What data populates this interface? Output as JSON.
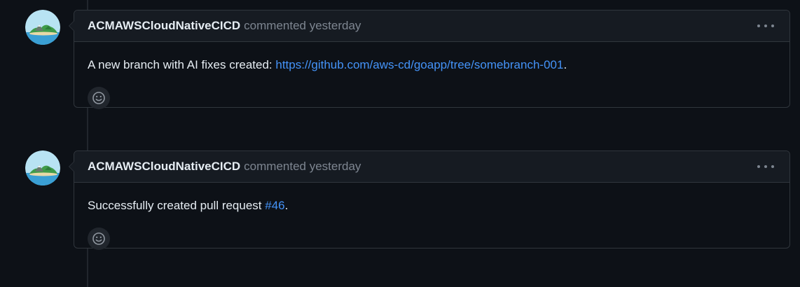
{
  "comments": [
    {
      "author": "ACMAWSCloudNativeCICD",
      "action": "commented yesterday",
      "body_prefix": "A new branch with AI fixes created: ",
      "link_text": "https://github.com/aws-cd/goapp/tree/somebranch-001",
      "body_suffix": ".",
      "menu_icon": "kebab-horizontal-icon",
      "reaction_icon": "smiley-icon",
      "avatar_icon": "island-avatar-icon"
    },
    {
      "author": "ACMAWSCloudNativeCICD",
      "action": "commented yesterday",
      "body_prefix": "Successfully created pull request ",
      "link_text": "#46",
      "body_suffix": ".",
      "menu_icon": "kebab-horizontal-icon",
      "reaction_icon": "smiley-icon",
      "avatar_icon": "island-avatar-icon"
    }
  ],
  "colors": {
    "background": "#0d1117",
    "header_bg": "#161b22",
    "border": "#30363d",
    "link": "#4493f8",
    "muted": "#7d8590",
    "text": "#e6edf3"
  }
}
